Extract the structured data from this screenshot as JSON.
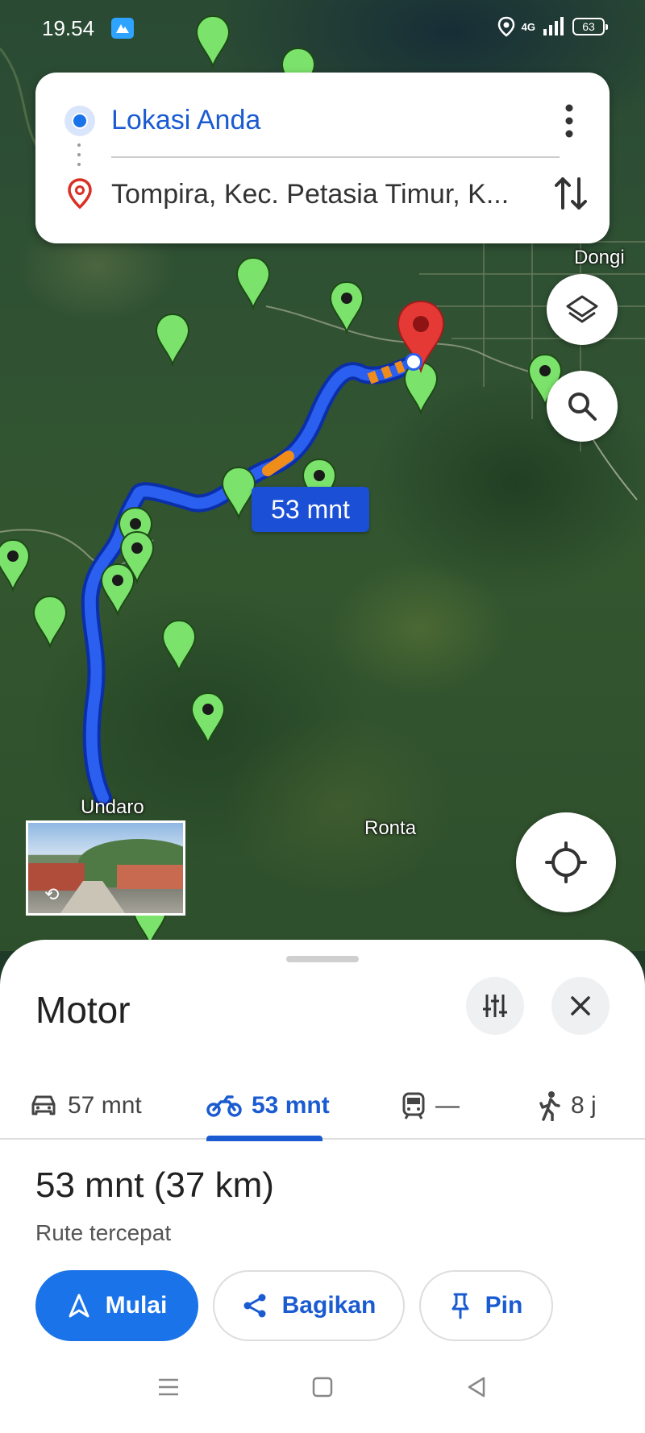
{
  "status_bar": {
    "time": "19.54",
    "network_label": "4G",
    "battery": "63"
  },
  "route_card": {
    "origin": "Lokasi Anda",
    "destination": "Tompira, Kec. Petasia Timur, K..."
  },
  "map": {
    "labels": {
      "dongi": "Dongi",
      "undaro": "Undaro",
      "ronta": "Ronta"
    },
    "route_badge": "53 mnt",
    "route_color": "#1a4fd6",
    "destination_pin_color": "#e53935",
    "poi_pin_color": "#7be36b"
  },
  "sheet": {
    "mode_title": "Motor",
    "tabs": [
      {
        "label": "57 mnt",
        "icon": "car-icon"
      },
      {
        "label": "53 mnt",
        "icon": "motorcycle-icon",
        "selected": true
      },
      {
        "label": "—",
        "icon": "transit-icon"
      },
      {
        "label": "8 j",
        "icon": "walk-icon"
      }
    ],
    "summary_time": "53 mnt",
    "summary_distance": "(37 km)",
    "subtitle": "Rute tercepat",
    "actions": {
      "start": "Mulai",
      "share": "Bagikan",
      "pin": "Pin"
    },
    "accent": "#1a73e8"
  }
}
